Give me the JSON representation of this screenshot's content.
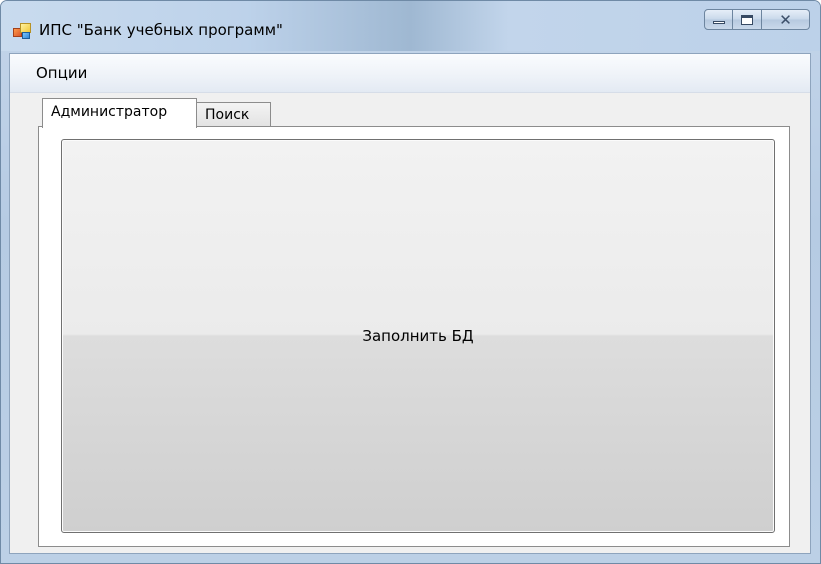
{
  "window": {
    "title": "ИПС \"Банк учебных программ\"",
    "icon": "app-icon",
    "caption_buttons": [
      {
        "name": "minimize-button",
        "icon": "minimize-icon"
      },
      {
        "name": "maximize-button",
        "icon": "maximize-icon"
      },
      {
        "name": "close-button",
        "icon": "close-icon",
        "glyph": "✕"
      }
    ]
  },
  "menu": {
    "items": [
      {
        "label": "Опции"
      }
    ]
  },
  "tabs": [
    {
      "label": "Администратор",
      "selected": true
    },
    {
      "label": "Поиск",
      "selected": false
    }
  ],
  "admin_panel": {
    "fill_db_button_label": "Заполнить БД"
  },
  "colors": {
    "titlebar": "#bcd1e9",
    "client_background": "#f0f0f0",
    "tab_panel_background": "#ffffff",
    "button_border": "#707070"
  }
}
